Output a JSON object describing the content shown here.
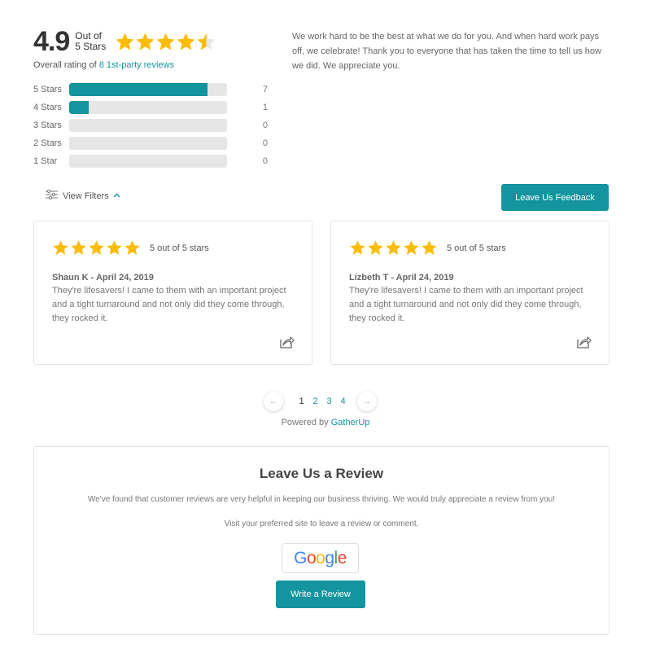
{
  "summary": {
    "score": "4.9",
    "out_of_line1": "Out of",
    "out_of_line2": "5 Stars",
    "star_rating": 4.5,
    "overall_prefix": "Overall rating of ",
    "overall_link": "8 1st-party reviews"
  },
  "distribution": [
    {
      "label": "5 Stars",
      "count": "7",
      "fraction": 0.875
    },
    {
      "label": "4 Stars",
      "count": "1",
      "fraction": 0.125
    },
    {
      "label": "3 Stars",
      "count": "0",
      "fraction": 0
    },
    {
      "label": "2 Stars",
      "count": "0",
      "fraction": 0
    },
    {
      "label": "1 Star",
      "count": "0",
      "fraction": 0
    }
  ],
  "intro_text": "We work hard to be the best at what we do for you. And when hard work pays off, we celebrate! Thank you to everyone that has taken the time to tell us how we did. We appreciate you.",
  "filters": {
    "label": "View Filters",
    "icon": "sliders-icon",
    "chevron": "chevron-up-icon"
  },
  "feedback_button": "Leave Us Feedback",
  "reviews": [
    {
      "rating": 5,
      "rating_text": "5 out of 5 stars",
      "author": "Shaun K - April 24, 2019",
      "body": "They're lifesavers! I came to them with an important project and a tight turnaround and not only did they come through, they rocked it.",
      "icon": "share-icon"
    },
    {
      "rating": 5,
      "rating_text": "5 out of 5 stars",
      "author": "Lizbeth T - April 24, 2019",
      "body": "They're lifesavers! I came to them with an important project and a tight turnaround and not only did they come through, they rocked it.",
      "icon": "share-icon"
    }
  ],
  "pagination": {
    "prev": "←",
    "next": "→",
    "pages": [
      "1",
      "2",
      "3",
      "4"
    ],
    "current": "1"
  },
  "powered": {
    "prefix": "Powered by ",
    "link": "GatherUp"
  },
  "leave_review": {
    "title": "Leave Us a Review",
    "description": "We've found that customer reviews are very helpful in keeping our business thriving. We would truly appreciate a review from you!",
    "visit": "Visit your preferred site to leave a review or comment.",
    "site_button": "Google",
    "write_button": "Write a Review"
  },
  "colors": {
    "accent": "#13949e",
    "star": "#fbbc05",
    "star_empty": "#e6e6e6",
    "bar_track": "#e6e6e6"
  }
}
